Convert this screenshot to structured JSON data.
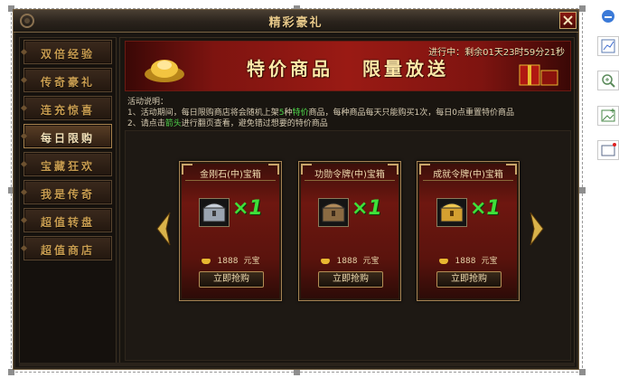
{
  "window": {
    "title": "精彩豪礼",
    "close_label": "✕"
  },
  "sidebar": {
    "items": [
      {
        "label": "双倍经验",
        "active": false
      },
      {
        "label": "传奇豪礼",
        "active": false
      },
      {
        "label": "连充惊喜",
        "active": false
      },
      {
        "label": "每日限购",
        "active": true
      },
      {
        "label": "宝藏狂欢",
        "active": false
      },
      {
        "label": "我是传奇",
        "active": false
      },
      {
        "label": "超值转盘",
        "active": false
      },
      {
        "label": "超值商店",
        "active": false
      }
    ]
  },
  "banner": {
    "countdown": "进行中：剩余01天23时59分21秒",
    "title_left": "特价商品",
    "title_right": "限量放送"
  },
  "description": {
    "heading": "活动说明：",
    "line1_a": "1、活动期间，每日限购商店将会随机上架",
    "line1_hl1": "5",
    "line1_b": "种",
    "line1_hl2": "特价",
    "line1_c": "商品，每种商品每天只能购买1次，每日0点重置特价商品",
    "line2_a": "2、请点击",
    "line2_hl": "箭头",
    "line2_b": "进行翻页查看，避免错过想要的特价商品"
  },
  "cards": [
    {
      "name": "金刚石(中)宝箱",
      "multiplier": "×1",
      "price": "1888",
      "currency": "元宝",
      "button": "立即抢购",
      "chest_color": "#9aa4b0"
    },
    {
      "name": "功勋令牌(中)宝箱",
      "multiplier": "×1",
      "price": "1888",
      "currency": "元宝",
      "button": "立即抢购",
      "chest_color": "#8a6a42"
    },
    {
      "name": "成就令牌(中)宝箱",
      "multiplier": "×1",
      "price": "1888",
      "currency": "元宝",
      "button": "立即抢购",
      "chest_color": "#d4a030"
    }
  ],
  "colors": {
    "accent_gold": "#c9a56a",
    "highlight_green": "#4fd84b",
    "banner_red": "#9a1a14"
  },
  "toolbar": {
    "icons": [
      "minus-circle-icon",
      "chart-icon",
      "zoom-in-icon",
      "image-add-icon",
      "window-icon"
    ]
  }
}
